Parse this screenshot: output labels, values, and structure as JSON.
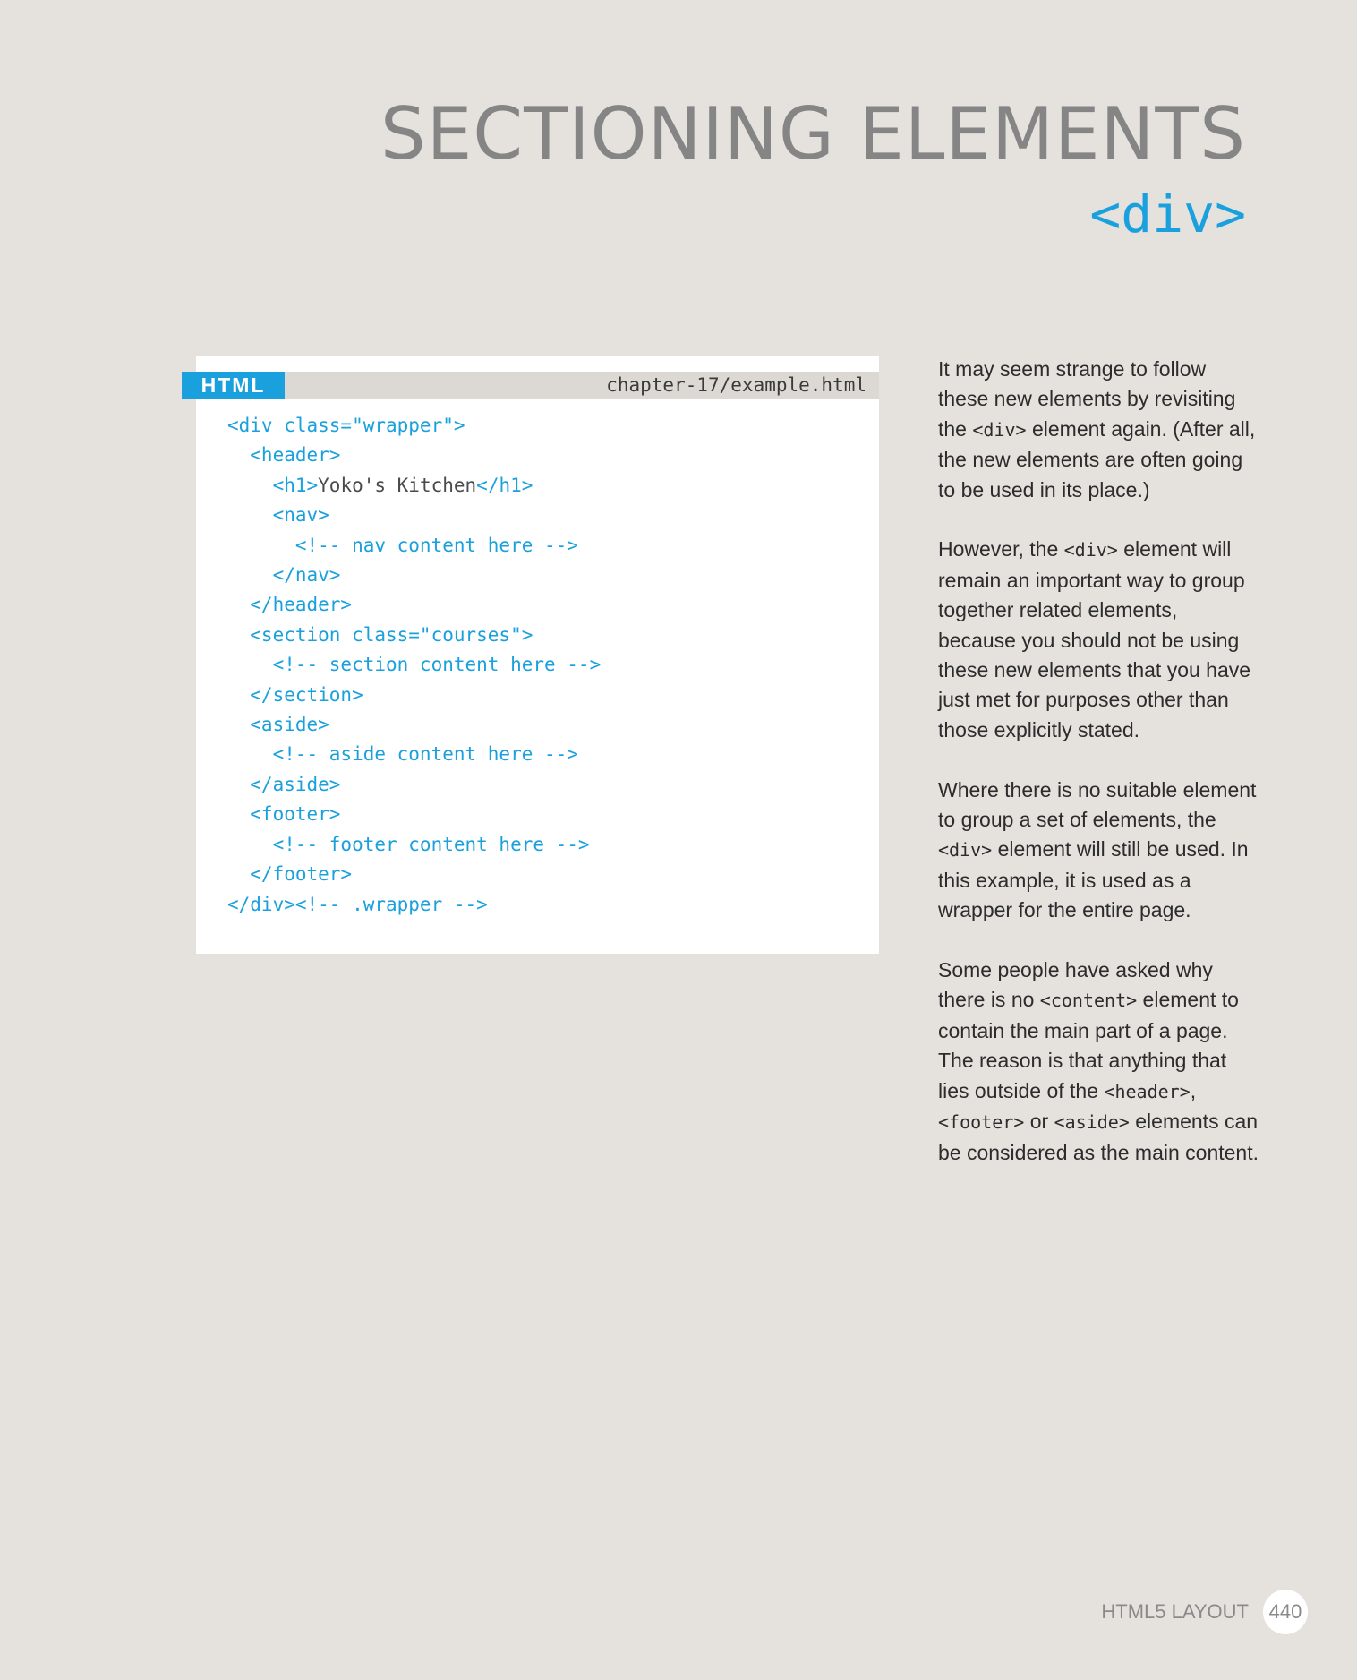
{
  "header": {
    "title": "SECTIONING ELEMENTS",
    "subtitle": "<div>"
  },
  "code_block": {
    "language": "HTML",
    "filename": "chapter-17/example.html",
    "lines": [
      {
        "tag_before": "<div class=\"wrapper\">",
        "text": "",
        "tag_after": ""
      },
      {
        "tag_before": "  <header>",
        "text": "",
        "tag_after": ""
      },
      {
        "tag_before": "    <h1>",
        "text": "Yoko's Kitchen",
        "tag_after": "</h1>"
      },
      {
        "tag_before": "    <nav>",
        "text": "",
        "tag_after": ""
      },
      {
        "tag_before": "      <!-- nav content here -->",
        "text": "",
        "tag_after": ""
      },
      {
        "tag_before": "    </nav>",
        "text": "",
        "tag_after": ""
      },
      {
        "tag_before": "  </header>",
        "text": "",
        "tag_after": ""
      },
      {
        "tag_before": "  <section class=\"courses\">",
        "text": "",
        "tag_after": ""
      },
      {
        "tag_before": "    <!-- section content here -->",
        "text": "",
        "tag_after": ""
      },
      {
        "tag_before": "  </section>",
        "text": "",
        "tag_after": ""
      },
      {
        "tag_before": "  <aside>",
        "text": "",
        "tag_after": ""
      },
      {
        "tag_before": "    <!-- aside content here -->",
        "text": "",
        "tag_after": ""
      },
      {
        "tag_before": "  </aside>",
        "text": "",
        "tag_after": ""
      },
      {
        "tag_before": "  <footer>",
        "text": "",
        "tag_after": ""
      },
      {
        "tag_before": "    <!-- footer content here -->",
        "text": "",
        "tag_after": ""
      },
      {
        "tag_before": "  </footer>",
        "text": "",
        "tag_after": ""
      },
      {
        "tag_before": "</div><!-- .wrapper -->",
        "text": "",
        "tag_after": ""
      }
    ]
  },
  "body": {
    "p1": {
      "a": "It may seem strange to follow these new elements by revisiting the ",
      "code1": "<div>",
      "b": " element again. (After all, the new elements are often going to be used in its place.)"
    },
    "p2": {
      "a": "However, the ",
      "code1": "<div>",
      "b": " element will remain an important way to group together related elements, because you should not be using these new elements that you have just met for purposes other than those explicitly stated."
    },
    "p3": {
      "a": "Where there is no suitable element to group a set of elements, the ",
      "code1": "<div>",
      "b": " element will still be used. In this example, it is used as a wrapper for the entire page."
    },
    "p4": {
      "a": "Some people have asked why there is no ",
      "code1": "<content>",
      "b": " element to contain the main part of a page. The reason is that anything that lies outside of the ",
      "code2": "<header>",
      "c": ", ",
      "code3": "<footer>",
      "d": " or ",
      "code4": "<aside>",
      "e": " elements can be considered as the main content."
    }
  },
  "footer": {
    "section_label": "HTML5 LAYOUT",
    "page_number": "440"
  },
  "colors": {
    "accent": "#1aa1dd",
    "page_background": "#e5e2de",
    "title_gray": "#858585"
  }
}
